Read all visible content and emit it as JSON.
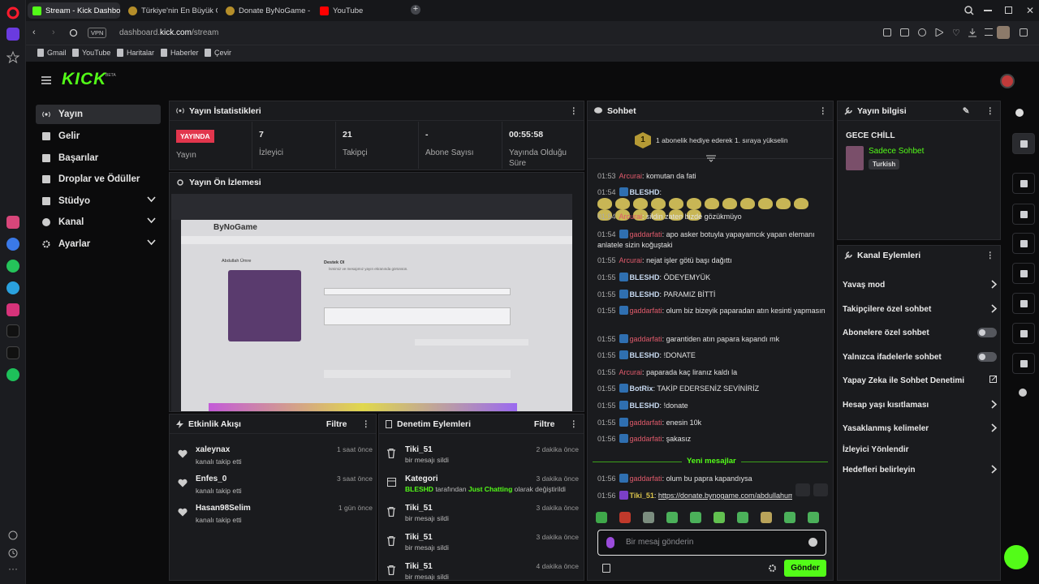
{
  "browser": {
    "tabs": [
      {
        "label": "Stream - Kick Dashboard",
        "active": true
      },
      {
        "label": "Türkiye'nin En Büyük Oyun"
      },
      {
        "label": "Donate ByNoGame - Abd"
      },
      {
        "label": "YouTube"
      }
    ],
    "vpn_label": "VPN",
    "url_prefix": "dashboard.",
    "url_domain": "kick.com",
    "url_path": "/stream",
    "bookmarks": [
      "Gmail",
      "YouTube",
      "Haritalar",
      "Haberler",
      "Çevir"
    ]
  },
  "kick": {
    "logo": "KICK",
    "logo_sup": "BETA",
    "accent": "#53fc18",
    "nav": [
      {
        "label": "Yayın",
        "icon": "broadcast-icon",
        "active": true
      },
      {
        "label": "Gelir",
        "icon": "wallet-icon"
      },
      {
        "label": "Başarılar",
        "icon": "trophy-icon"
      },
      {
        "label": "Droplar ve Ödüller",
        "icon": "gift-icon"
      },
      {
        "label": "Stüdyo",
        "icon": "studio-icon",
        "expandable": true
      },
      {
        "label": "Kanal",
        "icon": "user-icon",
        "expandable": true
      },
      {
        "label": "Ayarlar",
        "icon": "gear-icon",
        "expandable": true
      }
    ]
  },
  "stats": {
    "title": "Yayın İstatistikleri",
    "live_badge": "YAYINDA",
    "items": [
      {
        "value": "",
        "label": "Yayın"
      },
      {
        "value": "7",
        "label": "İzleyici"
      },
      {
        "value": "21",
        "label": "Takipçi"
      },
      {
        "value": "-",
        "label": "Abone Sayısı"
      },
      {
        "value": "00:55:58",
        "label": "Yayında Olduğu Süre"
      }
    ]
  },
  "preview": {
    "title": "Yayın Ön İzlemesi",
    "site_name": "ByNoGame",
    "streamer": "Abdullah Ümre",
    "support_heading": "Destek Ol",
    "hint": "İsmimiz ve mesajımız yayın ekranında görünsün."
  },
  "activity": {
    "title": "Etkinlik Akışı",
    "filter": "Filtre",
    "items": [
      {
        "name": "xaleynax",
        "desc": "kanalı takip etti",
        "time": "1 saat önce"
      },
      {
        "name": "Enfes_0",
        "desc": "kanalı takip etti",
        "time": "3 saat önce"
      },
      {
        "name": "Hasan98Selim",
        "desc": "kanalı takip etti",
        "time": "1 gün önce"
      }
    ]
  },
  "moderation": {
    "title": "Denetim Eylemleri",
    "filter": "Filtre",
    "items": [
      {
        "name": "Tiki_51",
        "desc": "bir mesajı sildi",
        "time": "2 dakika önce",
        "icon": "trash-icon"
      },
      {
        "name": "Kategori",
        "desc_user": "BLESHD",
        "desc_mid": " tarafından ",
        "desc_cat": "Just Chatting",
        "desc_end": " olarak değiştirildi",
        "time": "3 dakika önce",
        "icon": "category-icon"
      },
      {
        "name": "Tiki_51",
        "desc": "bir mesajı sildi",
        "time": "3 dakika önce",
        "icon": "trash-icon"
      },
      {
        "name": "Tiki_51",
        "desc": "bir mesajı sildi",
        "time": "3 dakika önce",
        "icon": "trash-icon"
      },
      {
        "name": "Tiki_51",
        "desc": "bir mesajı sildi",
        "time": "4 dakika önce",
        "icon": "trash-icon"
      }
    ]
  },
  "chat": {
    "title": "Sohbet",
    "gift_rank": "1",
    "gift_text": "1 abonelik hediye ederek 1. sıraya yükselin",
    "messages": [
      {
        "time": "01:53",
        "user": "Arcurai",
        "color": "red",
        "text": "komutan da fati"
      },
      {
        "time": "01:54",
        "user": "BLESHD",
        "color": "blue",
        "badge": true,
        "text": "",
        "emotes": 18
      },
      {
        "time": "01:54",
        "user": "Arcurai",
        "color": "red",
        "text": "sildin zaten bizde gözükmüyo"
      },
      {
        "time": "01:54",
        "user": "gaddarfati",
        "color": "red",
        "badge": true,
        "text": "apo asker botuyla yapayamcık yapan elemanı anlatele sizin koğuştaki"
      },
      {
        "time": "01:55",
        "user": "Arcurai",
        "color": "red",
        "text": "nejat işler götü başı dağıttı"
      },
      {
        "time": "01:55",
        "user": "BLESHD",
        "color": "blue",
        "badge": true,
        "text": "ÖDEYEMYÜK"
      },
      {
        "time": "01:55",
        "user": "BLESHD",
        "color": "blue",
        "badge": true,
        "text": "PARAMIZ BİTTİ"
      },
      {
        "time": "01:55",
        "user": "gaddarfati",
        "color": "red",
        "badge": true,
        "text": "olum biz bizeyik paparadan atın kesinti yapmasın"
      },
      {
        "time": "01:55",
        "user": "gaddarfati",
        "color": "red",
        "badge": true,
        "text": "garantiden atın papara kapandı mk"
      },
      {
        "time": "01:55",
        "user": "BLESHD",
        "color": "blue",
        "badge": true,
        "text": "!DONATE"
      },
      {
        "time": "01:55",
        "user": "Arcurai",
        "color": "red",
        "text": "paparada kaç liranız kaldı la"
      },
      {
        "time": "01:55",
        "user": "BotRix",
        "color": "green",
        "badge": true,
        "text": "TAKİP EDERSENİZ SEVİNİRİZ"
      },
      {
        "time": "01:55",
        "user": "BLESHD",
        "color": "blue",
        "badge": true,
        "text": "!donate"
      },
      {
        "time": "01:55",
        "user": "gaddarfati",
        "color": "red",
        "badge": true,
        "text": "enesin 10k"
      },
      {
        "time": "01:56",
        "user": "gaddarfati",
        "color": "red",
        "badge": true,
        "text": "şakasız"
      }
    ],
    "new_messages_label": "Yeni mesajlar",
    "after_new": [
      {
        "time": "01:56",
        "user": "gaddarfati",
        "color": "red",
        "badge": true,
        "text": "olum bu papra kapandıysa"
      },
      {
        "time": "01:56",
        "user": "Tiki_51",
        "color": "yellow",
        "text": "https://donate.bynogame.com/abdullahumre"
      }
    ],
    "input_placeholder": "Bir mesaj gönderin",
    "send_label": "Gönder"
  },
  "stream_info": {
    "title": "Yayın bilgisi",
    "stream_title": "GECE CHİLL",
    "category": "Sadece Sohbet",
    "tag": "Turkish"
  },
  "channel_actions": {
    "title": "Kanal Eylemleri",
    "items": [
      {
        "label": "Yavaş mod",
        "kind": "chevron"
      },
      {
        "label": "Takipçilere özel sohbet",
        "kind": "chevron"
      },
      {
        "label": "Abonelere özel sohbet",
        "kind": "toggle"
      },
      {
        "label": "Yalnızca ifadelerle sohbet",
        "kind": "toggle"
      },
      {
        "label": "Yapay Zeka ile Sohbet Denetimi",
        "kind": "external"
      },
      {
        "label": "Hesap yaşı kısıtlaması",
        "kind": "chevron"
      },
      {
        "label": "Yasaklanmış kelimeler",
        "kind": "chevron"
      },
      {
        "label": "İzleyici Yönlendir",
        "kind": "none"
      },
      {
        "label": "Hedefleri belirleyin",
        "kind": "chevron"
      }
    ]
  }
}
